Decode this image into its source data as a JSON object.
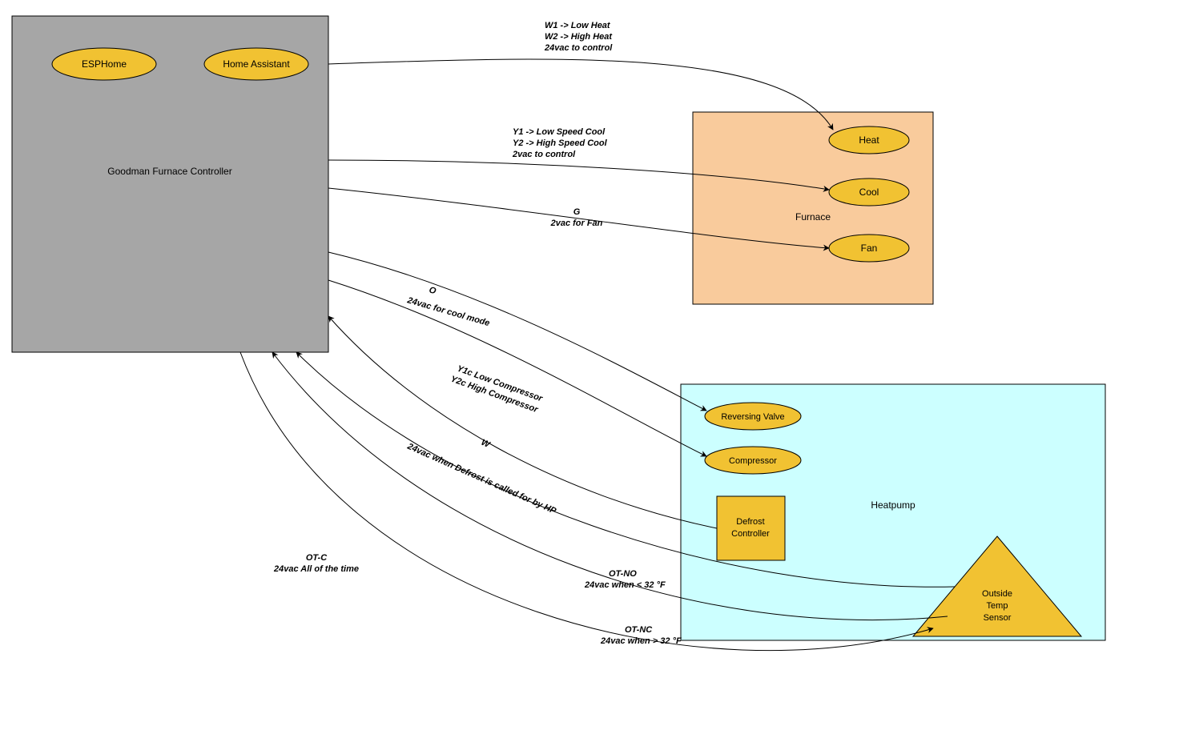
{
  "colors": {
    "controller_fill": "#a6a6a6",
    "furnace_fill": "#f9cb9c",
    "heatpump_fill": "#ccffff",
    "shape_fill": "#f1c232",
    "stroke": "#000000"
  },
  "controller": {
    "title": "Goodman Furnace Controller",
    "esphome": "ESPHome",
    "ha": "Home Assistant"
  },
  "furnace": {
    "title": "Furnace",
    "heat": "Heat",
    "cool": "Cool",
    "fan": "Fan"
  },
  "heatpump": {
    "title": "Heatpump",
    "rev": "Reversing Valve",
    "comp": "Compressor",
    "defrost_l1": "Defrost",
    "defrost_l2": "Controller",
    "ots_l1": "Outside",
    "ots_l2": "Temp",
    "ots_l3": "Sensor"
  },
  "edges": {
    "w_heat_l1": "W1 -> Low Heat",
    "w_heat_l2": "W2 -> High Heat",
    "w_heat_l3": "24vac to control",
    "y_cool_l1": "Y1 -> Low Speed Cool",
    "y_cool_l2": "Y2 -> High Speed Cool",
    "y_cool_l3": "2vac to control",
    "g_fan_l1": "G",
    "g_fan_l2": "2vac for Fan",
    "o_rev_l1": "O",
    "o_rev_l2": "24vac for cool mode",
    "yc_comp_l1": "Y1c Low Compressor",
    "yc_comp_l2": "Y2c High Compressor",
    "w_def_l1": "W",
    "w_def_l2": "24vac when Defrost is called for by HP",
    "otno_l1": "OT-NO",
    "otno_l2": "24vac when < 32 °F",
    "otnc_l1": "OT-NC",
    "otnc_l2": "24vac when > 32 °F",
    "otc_l1": "OT-C",
    "otc_l2": "24vac All of the time"
  }
}
